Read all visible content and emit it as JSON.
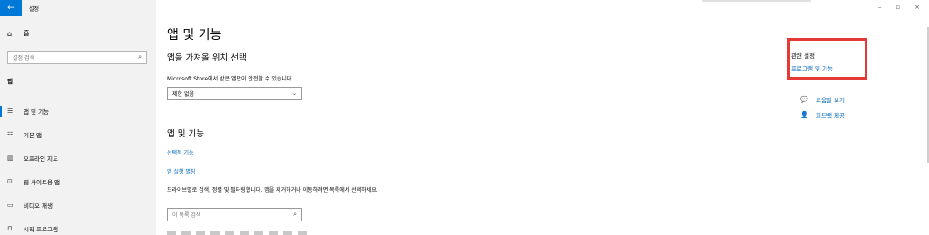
{
  "titlebar": {
    "app_title": "설정",
    "back_icon": "back-arrow-icon",
    "window_controls": [
      "–",
      "▫",
      "×"
    ]
  },
  "sidebar": {
    "home_label": "홈",
    "search_placeholder": "설정 검색",
    "section_label": "앱",
    "items": [
      {
        "label": "앱 및 기능",
        "icon": "apps-list-icon",
        "active": true
      },
      {
        "label": "기본 앱",
        "icon": "default-apps-icon",
        "active": false
      },
      {
        "label": "오프라인 지도",
        "icon": "map-icon",
        "active": false
      },
      {
        "label": "웹 사이트용 앱",
        "icon": "website-apps-icon",
        "active": false
      },
      {
        "label": "비디오 재생",
        "icon": "video-icon",
        "active": false
      },
      {
        "label": "시작 프로그램",
        "icon": "startup-icon",
        "active": false
      }
    ]
  },
  "main": {
    "page_title": "앱 및 기능",
    "choose_heading": "앱을 가져올 위치 선택",
    "choose_desc": "Microsoft Store에서 받은 앱만이 안전할 수 있습니다.",
    "choose_select_value": "제한 없음",
    "apps_heading": "앱 및 기능",
    "optional_features_link": "선택적 기능",
    "app_aliases_link": "앱 실행 별칭",
    "apps_desc": "드라이브별로 검색, 정렬 및 필터링합니다. 앱을 제거하거나 이동하려면 목록에서 선택하세요.",
    "list_search_placeholder": "이 목록 검색"
  },
  "related": {
    "title": "관련 설정",
    "programs_link": "프로그램 및 기능",
    "help_items": [
      {
        "label": "도움말 보기",
        "icon": "help-chat-icon"
      },
      {
        "label": "피드백 제공",
        "icon": "feedback-person-icon"
      }
    ],
    "highlight_color": "#e53935"
  },
  "colors": {
    "accent": "#0078d7",
    "link": "#0067b8"
  }
}
